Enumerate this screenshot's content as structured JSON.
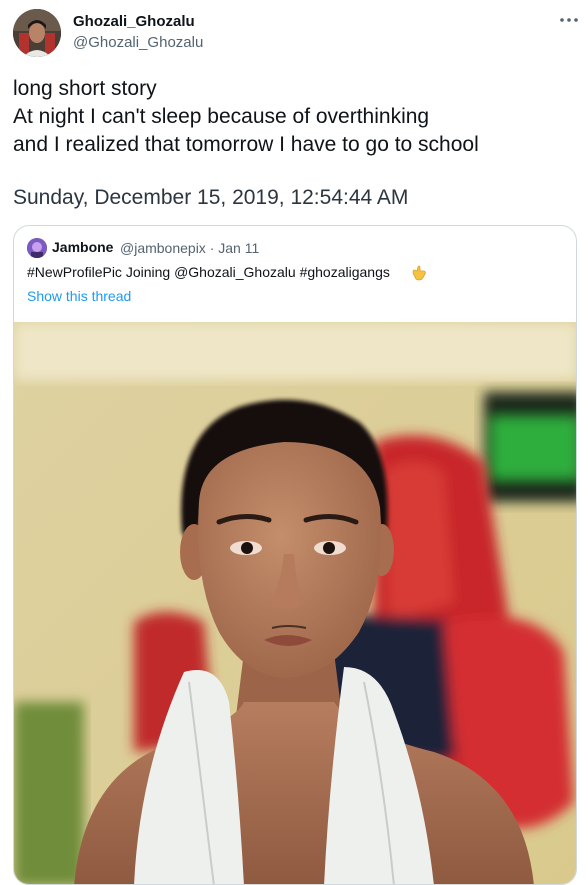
{
  "author": {
    "display_name": "Ghozali_Ghozalu",
    "handle": "@Ghozali_Ghozalu",
    "avatar_icon": "profile-avatar"
  },
  "more_icon": "more-horizontal-icon",
  "tweet": {
    "lines": [
      "long short story",
      "At night I can't sleep because of overthinking",
      "and I realized that tomorrow I have to go to school"
    ],
    "timestamp": "Sunday, December 15, 2019, 12:54:44 AM"
  },
  "quote": {
    "author_name": "Jambone",
    "author_handle_and_date": "@jambonepix · Jan 11",
    "text": "#NewProfilePic Joining @Ghozali_Ghozalu #ghozaligangs",
    "emoji_icon": "call-me-hand-icon",
    "show_thread": "Show this thread",
    "link_color": "#1d9bf0",
    "photo": "selfie-photo-gaming-chair-background"
  }
}
